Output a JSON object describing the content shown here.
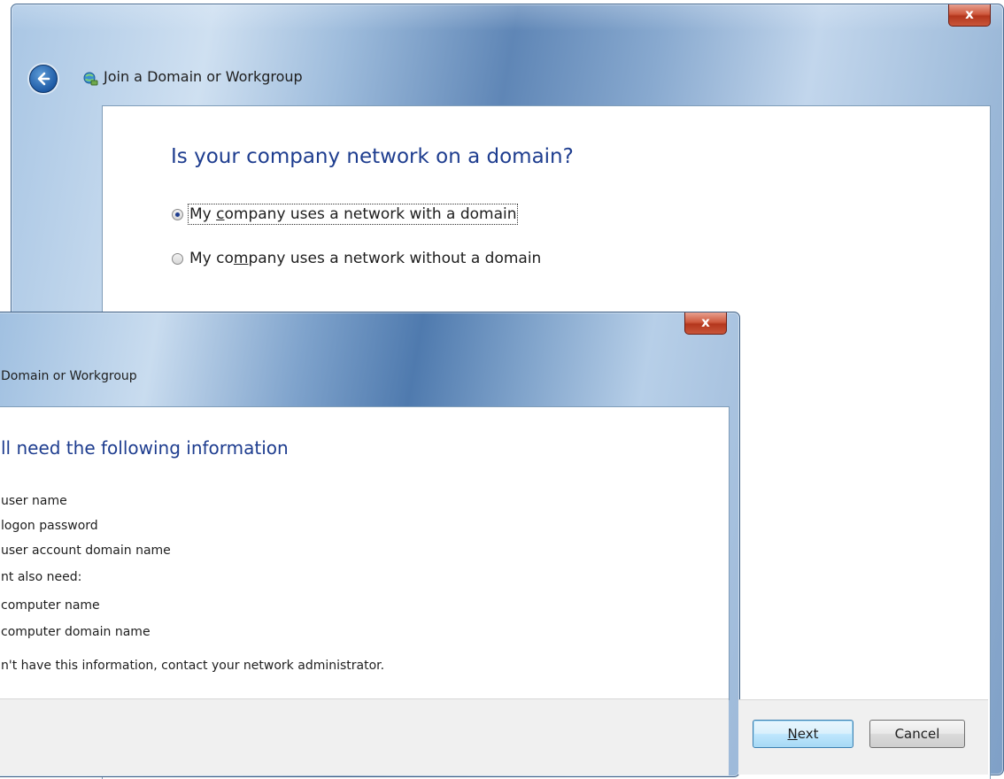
{
  "back_window": {
    "close_label": "x",
    "nav_title": "Join a Domain or Workgroup",
    "heading": "Is your company network on a domain?",
    "options": [
      {
        "pre": "My ",
        "mn": "c",
        "post": "ompany uses a network with a domain",
        "checked": true
      },
      {
        "pre": "My co",
        "mn": "m",
        "post": "pany uses a network without a domain",
        "checked": false
      }
    ]
  },
  "front_window": {
    "close_label": "x",
    "nav_title": "Domain or Workgroup",
    "heading": "ll need the following information",
    "lines": [
      "user name",
      "logon password",
      "user account domain name",
      "nt also need:",
      "computer name",
      "computer domain name",
      "n't have this information, contact your network administrator."
    ],
    "next_button": {
      "mn": "N",
      "rest": "ext"
    },
    "cancel_button": "Cancel"
  },
  "colors": {
    "heading_blue": "#1e3d8f",
    "close_red": "#c9563a",
    "aero_blue": "#5f86b6"
  }
}
